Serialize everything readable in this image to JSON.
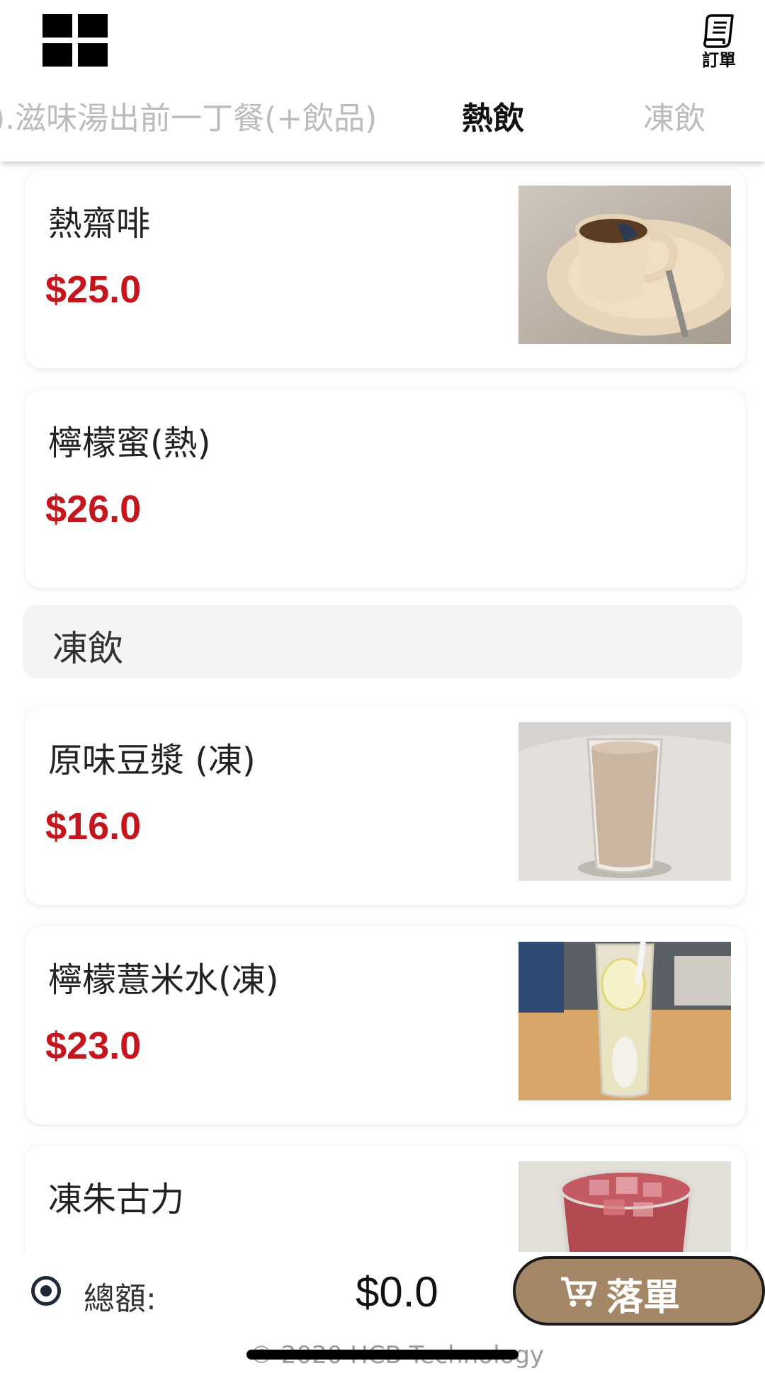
{
  "header": {
    "order_label": "訂單",
    "tabs": [
      {
        "label": ").滋味湯出前一丁餐(+飲品)"
      },
      {
        "label": "熱飲"
      },
      {
        "label": "凍飲"
      }
    ]
  },
  "menu": {
    "hot_items": [
      {
        "name": "熱齋啡",
        "price": "$25.0"
      },
      {
        "name": "檸檬蜜(熱)",
        "price": "$26.0"
      }
    ],
    "cold_section_title": "凍飲",
    "cold_items": [
      {
        "name": "原味豆漿 (凍)",
        "price": "$16.0"
      },
      {
        "name": "檸檬薏米水(凍)",
        "price": "$23.0"
      },
      {
        "name": "凍朱古力",
        "price": ""
      }
    ]
  },
  "footer": {
    "total_label": "總額:",
    "total_value": "$0.0",
    "submit_label": "落單",
    "copyright": "© 2020 HCB Technology"
  },
  "colors": {
    "accent": "#a38767",
    "price": "#c4161c",
    "section_bg": "#f3f4f5"
  }
}
